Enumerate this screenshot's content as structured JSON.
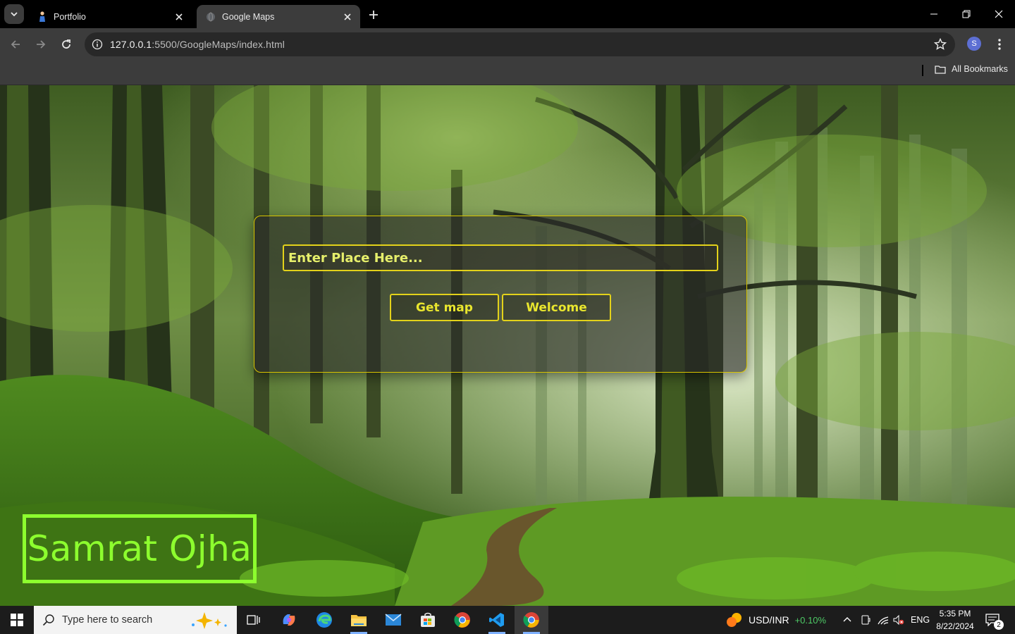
{
  "browser": {
    "tabs": [
      {
        "title": "Portfolio",
        "active": false
      },
      {
        "title": "Google Maps",
        "active": true
      }
    ],
    "url": {
      "host": "127.0.0.1",
      "rest": ":5500/GoogleMaps/index.html"
    },
    "profile_initial": "S",
    "bookmarks": {
      "all_label": "All Bookmarks"
    }
  },
  "page": {
    "search": {
      "placeholder": "Enter Place Here..."
    },
    "buttons": {
      "get_map": "Get map",
      "welcome": "Welcome"
    },
    "signature": "Samrat Ojha",
    "colors": {
      "accent_yellow": "#e3d21a",
      "signature_green": "#8dff2e"
    }
  },
  "taskbar": {
    "search_placeholder": "Type here to search",
    "currency": {
      "pair": "USD/INR",
      "change": "+0.10%"
    },
    "language": "ENG",
    "time": "5:35 PM",
    "date": "8/22/2024",
    "notifications": "2"
  }
}
